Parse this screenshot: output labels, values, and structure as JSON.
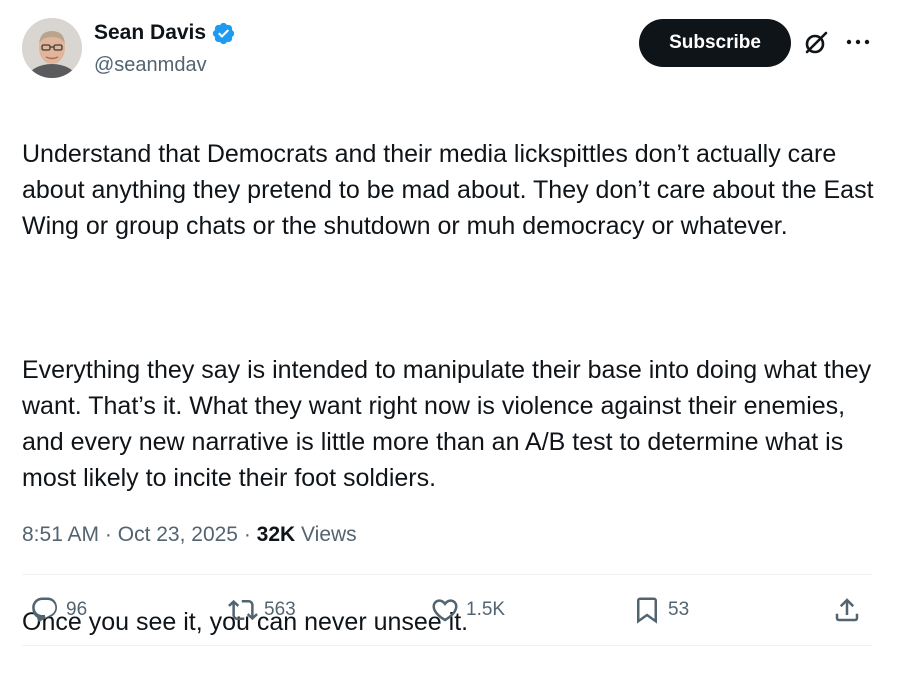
{
  "author": {
    "name": "Sean Davis",
    "handle": "@seanmdav",
    "verified_color": "#1d9bf0"
  },
  "header": {
    "subscribe_label": "Subscribe",
    "icons": [
      "grok-icon",
      "more-icon"
    ]
  },
  "tweet": {
    "paragraphs": [
      "Understand that Democrats and their media lickspittles don’t actually care about anything they pretend to be mad about. They don’t care about the East Wing or group chats or the shutdown or muh democracy or whatever.",
      "Everything they say is intended to manipulate their base into doing what they want. That’s it. What they want right now is violence against their enemies, and every new narrative is little more than an A/B test to determine what is most likely to incite their foot soldiers.",
      "Once you see it, you can never unsee it."
    ],
    "time": "8:51 AM",
    "date": "Oct 23, 2025",
    "views_count": "32K",
    "views_label": "Views"
  },
  "actions": {
    "replies": "96",
    "reposts": "563",
    "likes": "1.5K",
    "bookmarks": "53"
  },
  "colors": {
    "text_primary": "#0f1419",
    "text_secondary": "#536471",
    "button_bg": "#0f1419",
    "divider": "#eff3f4"
  }
}
